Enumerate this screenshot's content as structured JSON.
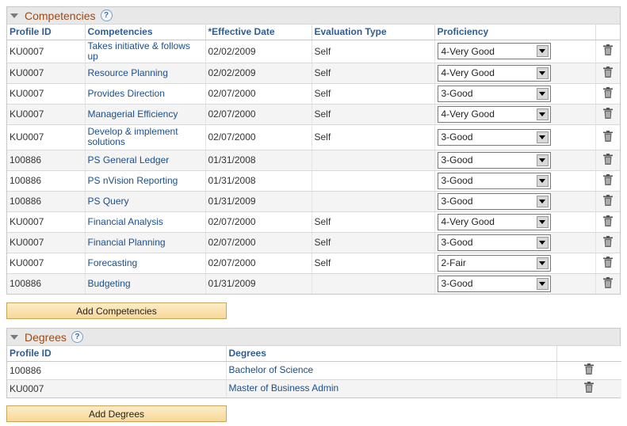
{
  "competencies": {
    "title": "Competencies",
    "help": "?",
    "columns": {
      "profile_id": "Profile ID",
      "competency": "Competencies",
      "effective_date": "*Effective Date",
      "evaluation_type": "Evaluation Type",
      "proficiency": "Proficiency"
    },
    "rows": [
      {
        "profile_id": "KU0007",
        "competency": "Takes initiative & follows up",
        "effective_date": "02/02/2009",
        "evaluation_type": "Self",
        "proficiency": "4-Very Good"
      },
      {
        "profile_id": "KU0007",
        "competency": "Resource Planning",
        "effective_date": "02/02/2009",
        "evaluation_type": "Self",
        "proficiency": "4-Very Good"
      },
      {
        "profile_id": "KU0007",
        "competency": "Provides Direction",
        "effective_date": "02/07/2000",
        "evaluation_type": "Self",
        "proficiency": "3-Good"
      },
      {
        "profile_id": "KU0007",
        "competency": "Managerial Efficiency",
        "effective_date": "02/07/2000",
        "evaluation_type": "Self",
        "proficiency": "4-Very Good"
      },
      {
        "profile_id": "KU0007",
        "competency": "Develop & implement solutions",
        "effective_date": "02/07/2000",
        "evaluation_type": "Self",
        "proficiency": "3-Good"
      },
      {
        "profile_id": "100886",
        "competency": "PS General Ledger",
        "effective_date": "01/31/2008",
        "evaluation_type": "",
        "proficiency": "3-Good"
      },
      {
        "profile_id": "100886",
        "competency": "PS nVision Reporting",
        "effective_date": "01/31/2008",
        "evaluation_type": "",
        "proficiency": "3-Good"
      },
      {
        "profile_id": "100886",
        "competency": "PS Query",
        "effective_date": "01/31/2009",
        "evaluation_type": "",
        "proficiency": "3-Good"
      },
      {
        "profile_id": "KU0007",
        "competency": "Financial Analysis",
        "effective_date": "02/07/2000",
        "evaluation_type": "Self",
        "proficiency": "4-Very Good"
      },
      {
        "profile_id": "KU0007",
        "competency": "Financial Planning",
        "effective_date": "02/07/2000",
        "evaluation_type": "Self",
        "proficiency": "3-Good"
      },
      {
        "profile_id": "KU0007",
        "competency": "Forecasting",
        "effective_date": "02/07/2000",
        "evaluation_type": "Self",
        "proficiency": "2-Fair"
      },
      {
        "profile_id": "100886",
        "competency": "Budgeting",
        "effective_date": "01/31/2009",
        "evaluation_type": "",
        "proficiency": "3-Good"
      }
    ],
    "add_button": "Add Competencies"
  },
  "degrees": {
    "title": "Degrees",
    "help": "?",
    "columns": {
      "profile_id": "Profile ID",
      "degree": "Degrees"
    },
    "rows": [
      {
        "profile_id": "100886",
        "degree": "Bachelor of Science"
      },
      {
        "profile_id": "KU0007",
        "degree": "Master of Business Admin"
      }
    ],
    "add_button": "Add Degrees"
  }
}
